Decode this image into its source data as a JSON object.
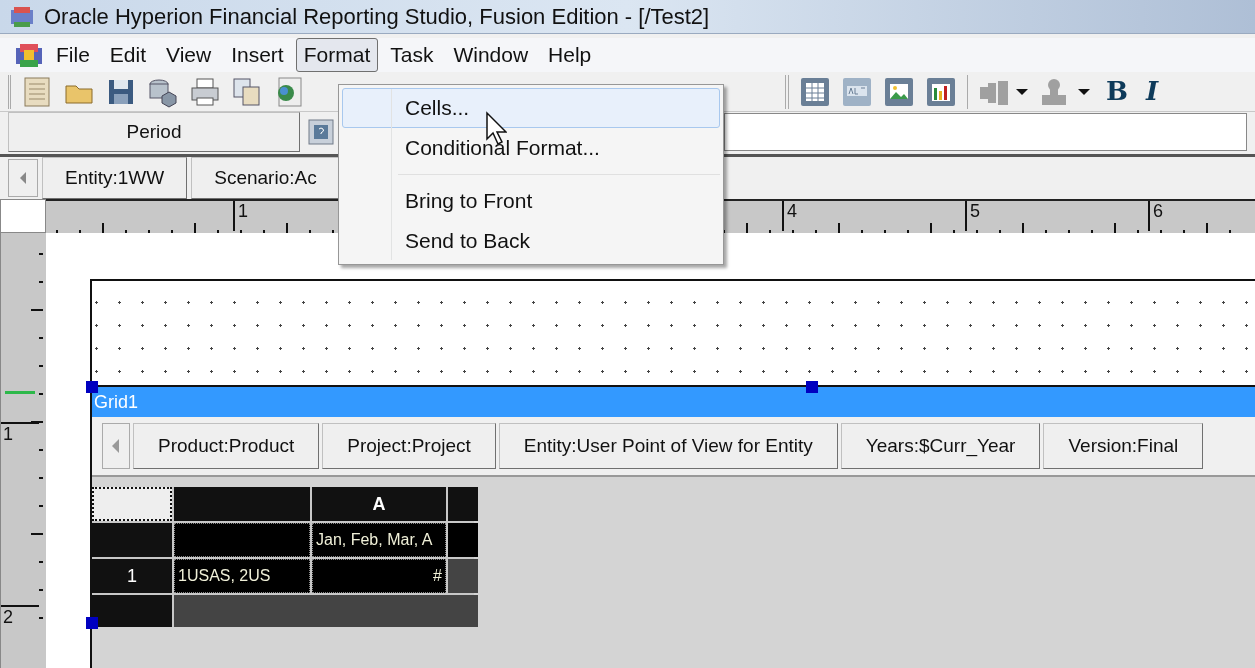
{
  "window": {
    "title": "Oracle Hyperion Financial Reporting Studio, Fusion Edition - [/Test2]"
  },
  "menu": [
    {
      "label": "File",
      "selected": false
    },
    {
      "label": "Edit",
      "selected": false
    },
    {
      "label": "View",
      "selected": false
    },
    {
      "label": "Insert",
      "selected": false
    },
    {
      "label": "Format",
      "selected": true
    },
    {
      "label": "Task",
      "selected": false
    },
    {
      "label": "Window",
      "selected": false
    },
    {
      "label": "Help",
      "selected": false
    }
  ],
  "format_menu": [
    {
      "kind": "item",
      "label": "Cells...",
      "selected": true
    },
    {
      "kind": "item",
      "label": "Conditional Format...",
      "selected": false
    },
    {
      "kind": "separator"
    },
    {
      "kind": "item",
      "label": "Bring to Front",
      "selected": false
    },
    {
      "kind": "item",
      "label": "Send to Back",
      "selected": false
    }
  ],
  "toolbar": {
    "bold": "B",
    "italic": "I"
  },
  "period_bar": {
    "button": "Period"
  },
  "pov_bar": [
    "Entity:1WW",
    "Scenario:Ac"
  ],
  "ruler": {
    "top_marks": [
      "1",
      "4",
      "5",
      "6"
    ],
    "left_marks": [
      "1",
      "2"
    ]
  },
  "grid": {
    "title": "Grid1",
    "pov": [
      "Product:Product",
      "Project:Project",
      "Entity:User Point of View for Entity",
      "Years:$Curr_Year",
      "Version:Final"
    ],
    "column_header": "A",
    "rows": [
      {
        "header": "",
        "cells": [
          "",
          "Jan, Feb, Mar, A"
        ]
      },
      {
        "header": "1",
        "cells": [
          "1USAS, 2US",
          "#"
        ]
      }
    ]
  }
}
